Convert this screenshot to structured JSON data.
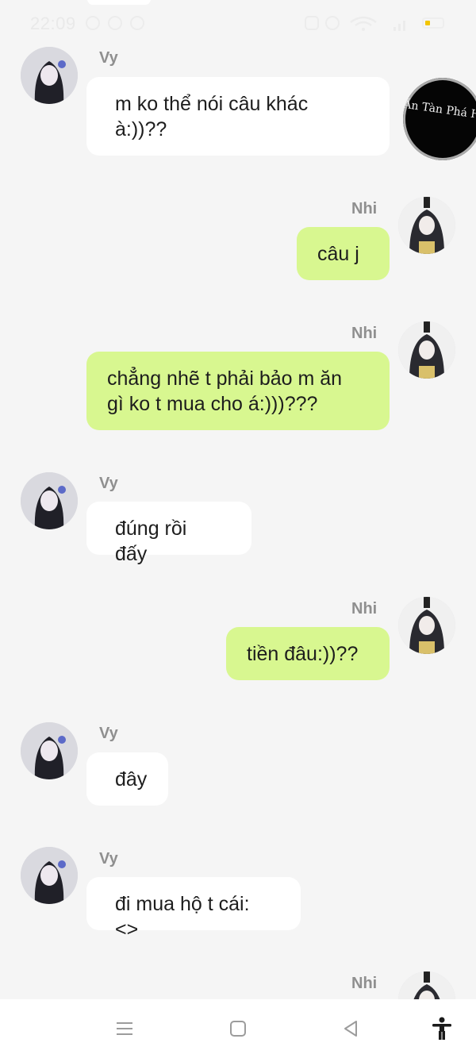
{
  "status_bar": {
    "time": "22:09"
  },
  "floating_bubble": {
    "text": "Ăn Tàn Phá Hại"
  },
  "messages": [
    {
      "sender": "Vy",
      "text_lines": [
        "m ko thể nói câu khác",
        "à:))??"
      ]
    },
    {
      "sender": "Nhi",
      "text_lines": [
        "câu j"
      ]
    },
    {
      "sender": "Nhi",
      "text_lines": [
        "chẳng nhẽ t phải bảo m ăn",
        "gì ko t mua cho á:)))???"
      ]
    },
    {
      "sender": "Vy",
      "text_lines": [
        "đúng rồi đấy"
      ]
    },
    {
      "sender": "Nhi",
      "text_lines": [
        "tiền đâu:))??"
      ]
    },
    {
      "sender": "Vy",
      "text_lines": [
        "đây"
      ]
    },
    {
      "sender": "Vy",
      "text_lines": [
        "đi mua hộ t cái:<>"
      ]
    },
    {
      "sender": "Nhi",
      "text_lines": []
    }
  ],
  "colors": {
    "background": "#f5f5f5",
    "incoming_bubble": "#ffffff",
    "outgoing_bubble": "#d8f790",
    "sender_name": "#8f8f8f"
  },
  "nav_icons": [
    "menu-icon",
    "home-square-icon",
    "back-triangle-icon",
    "accessibility-icon"
  ]
}
